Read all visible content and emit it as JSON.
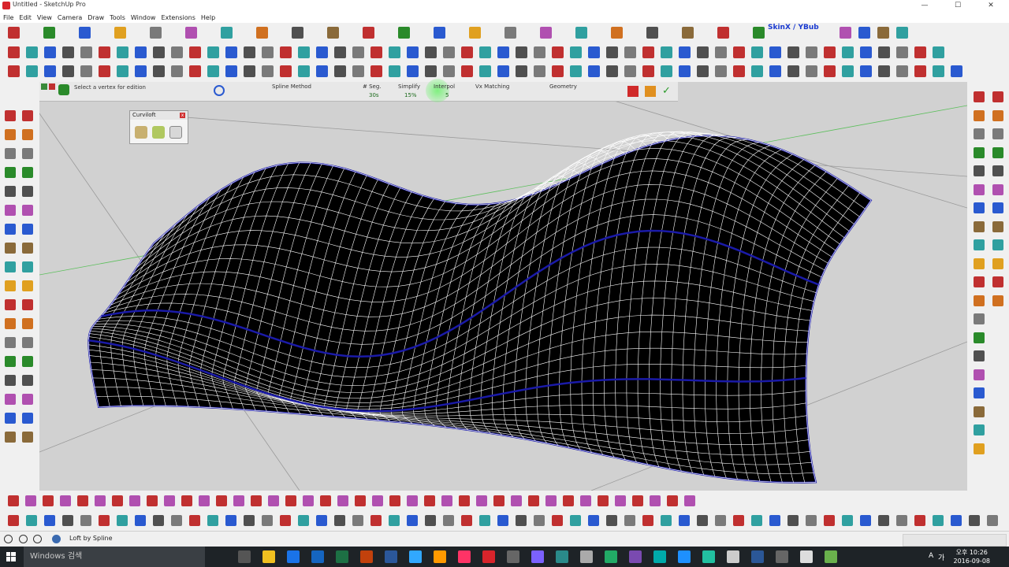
{
  "window": {
    "title": "Untitled - SketchUp Pro",
    "controls": [
      "—",
      "☐",
      "✕"
    ]
  },
  "menu": [
    "File",
    "Edit",
    "View",
    "Camera",
    "Draw",
    "Tools",
    "Window",
    "Extensions",
    "Help"
  ],
  "toolbar": {
    "skin_label": "SkinX / YBub"
  },
  "spline_toolbar": {
    "hint": "Select a vertex for edition",
    "spline_method_label": "Spline Method",
    "seg_label": "# Seg.",
    "seg_value": "30s",
    "simplify_label": "Simplify",
    "simplify_value": "15%",
    "interpol_label": "Interpol",
    "interpol_value": "5",
    "vx_matching_label": "Vx Matching",
    "geometry_label": "Geometry"
  },
  "curviloft_panel": {
    "title": "Curviloft",
    "close": "x"
  },
  "status": {
    "message": "Loft by Spline"
  },
  "taskbar": {
    "search_placeholder": "Windows 검색",
    "time": "오후 10:26",
    "date": "2016-09-08",
    "ime_lang": "A",
    "ime_mode": "가"
  },
  "colors": {
    "viewport_bg": "#d1d1d1",
    "surface_fill": "#000000",
    "mesh_line": "#ffffff",
    "edge_blue": "#1a1aa8",
    "axis_green": "#4caf50"
  }
}
